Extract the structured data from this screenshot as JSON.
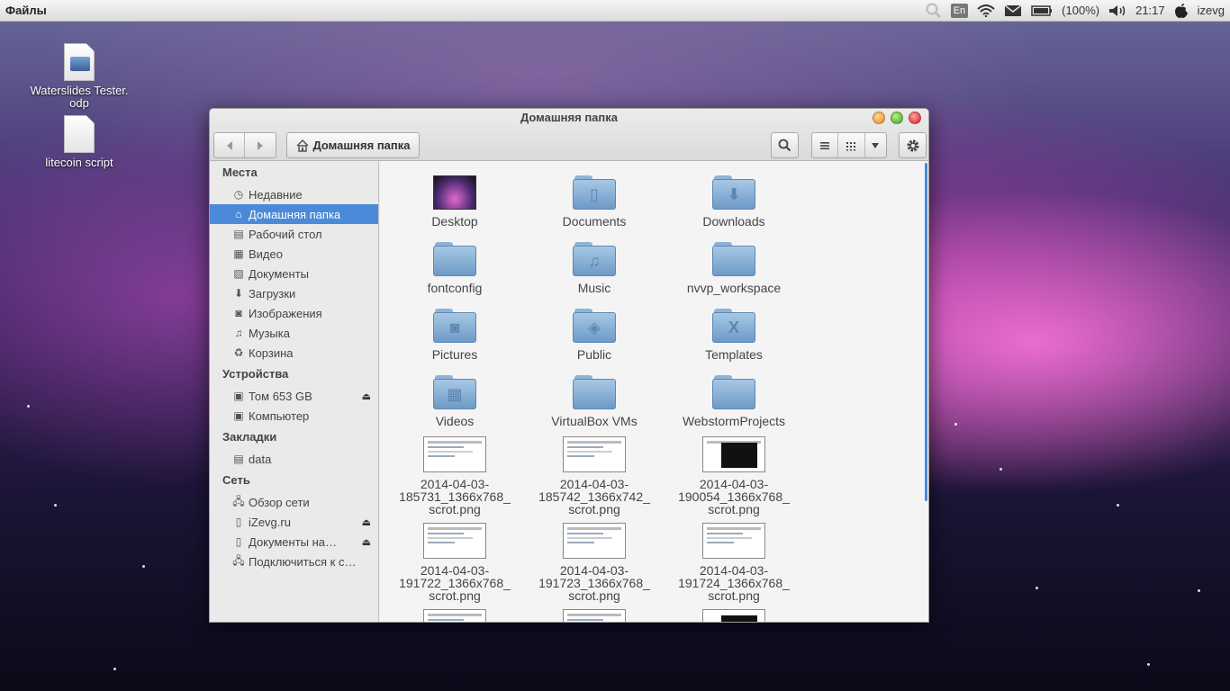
{
  "top_panel": {
    "app_name": "Файлы",
    "lang": "En",
    "battery": "(100%)",
    "time": "21:17",
    "user": "izevg",
    "icons": [
      "search-icon",
      "wifi-icon",
      "mail-icon",
      "battery-icon",
      "volume-icon",
      "apple-icon"
    ]
  },
  "desktop": {
    "icons": [
      {
        "label": "Waterslides Tester.",
        "label2": "odp"
      },
      {
        "label": "litecoin script"
      }
    ]
  },
  "window": {
    "title": "Домашняя папка",
    "location": "Домашняя папка"
  },
  "sidebar": {
    "places_heading": "Места",
    "places": [
      "Недавние",
      "Домашняя папка",
      "Рабочий стол",
      "Видео",
      "Документы",
      "Загрузки",
      "Изображения",
      "Музыка",
      "Корзина"
    ],
    "devices_heading": "Устройства",
    "devices": [
      "Том 653 GB",
      "Компьютер"
    ],
    "bookmarks_heading": "Закладки",
    "bookmarks": [
      "data"
    ],
    "network_heading": "Сеть",
    "network": [
      "Обзор сети",
      "iZevg.ru",
      "Документы на…",
      "Подключиться к с…"
    ]
  },
  "files": [
    {
      "name": "Desktop"
    },
    {
      "name": "Documents"
    },
    {
      "name": "Downloads"
    },
    {
      "name": "fontconfig"
    },
    {
      "name": "Music"
    },
    {
      "name": "nvvp_workspace"
    },
    {
      "name": "Pictures"
    },
    {
      "name": "Public"
    },
    {
      "name": "Templates"
    },
    {
      "name": "Videos"
    },
    {
      "name": "VirtualBox VMs"
    },
    {
      "name": "WebstormProjects"
    },
    {
      "l1": "2014-04-03-",
      "l2": "185731_1366x768_",
      "l3": "scrot.png"
    },
    {
      "l1": "2014-04-03-",
      "l2": "185742_1366x742_",
      "l3": "scrot.png"
    },
    {
      "l1": "2014-04-03-",
      "l2": "190054_1366x768_",
      "l3": "scrot.png"
    },
    {
      "l1": "2014-04-03-",
      "l2": "191722_1366x768_",
      "l3": "scrot.png"
    },
    {
      "l1": "2014-04-03-",
      "l2": "191723_1366x768_",
      "l3": "scrot.png"
    },
    {
      "l1": "2014-04-03-",
      "l2": "191724_1366x768_",
      "l3": "scrot.png"
    }
  ]
}
